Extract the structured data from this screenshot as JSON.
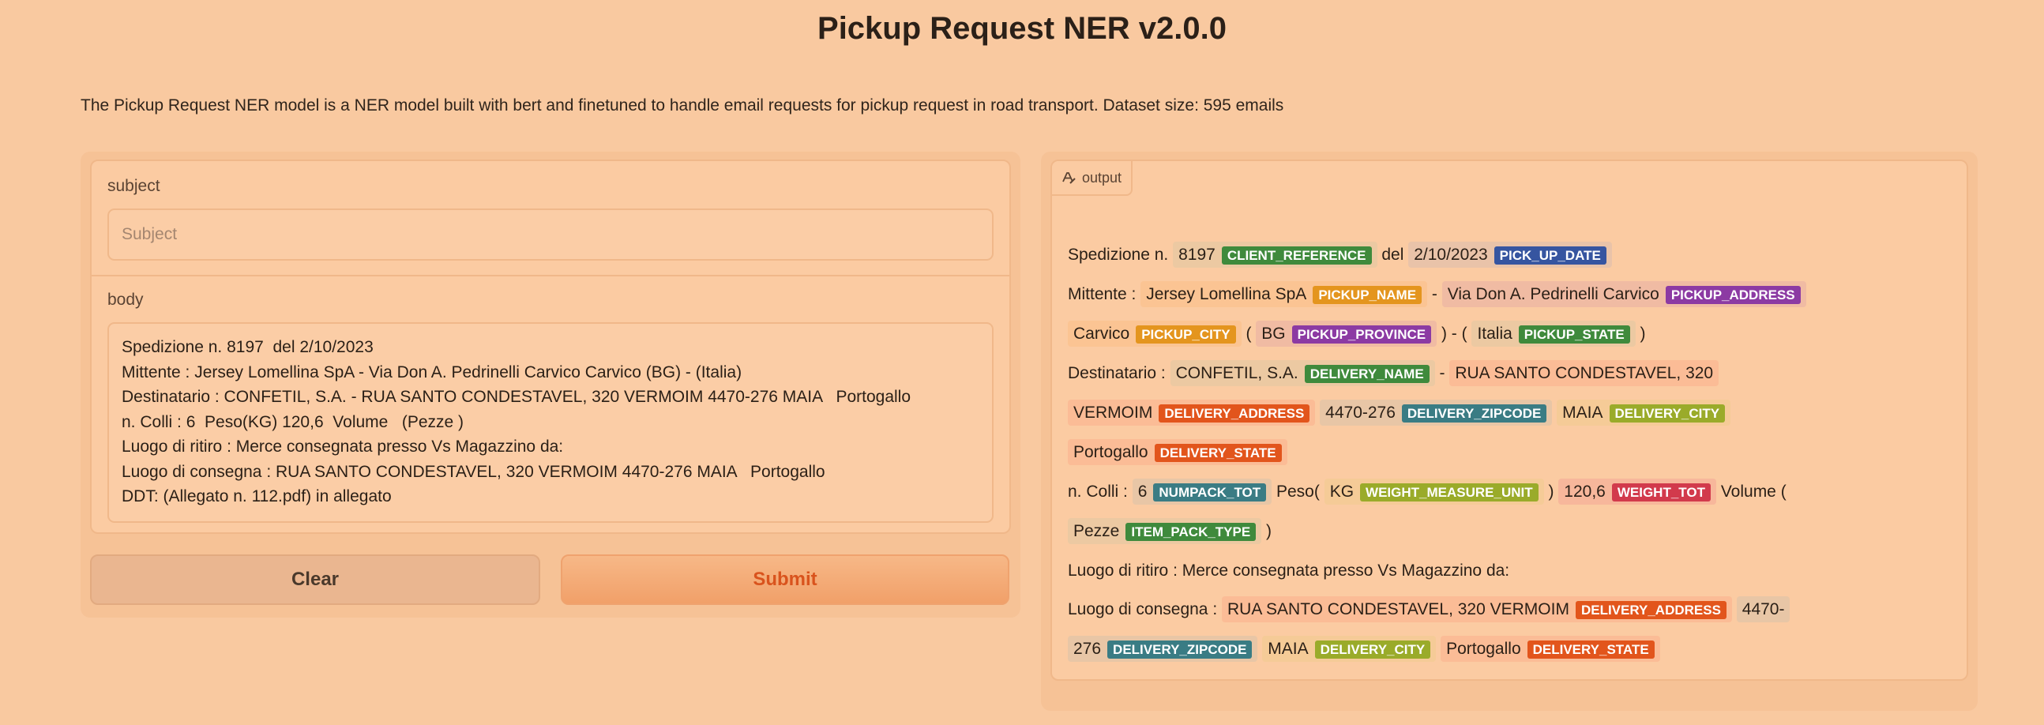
{
  "title": "Pickup Request NER v2.0.0",
  "description": "The Pickup Request NER model is a NER model built with bert and finetuned to handle email requests for pickup request in road transport. Dataset size: 595 emails",
  "form": {
    "subject_label": "subject",
    "subject_placeholder": "Subject",
    "subject_value": "",
    "body_label": "body",
    "body_value": "Spedizione n. 8197  del 2/10/2023\nMittente : Jersey Lomellina SpA - Via Don A. Pedrinelli Carvico Carvico (BG) - (Italia)\nDestinatario : CONFETIL, S.A. - RUA SANTO CONDESTAVEL, 320 VERMOIM 4470-276 MAIA   Portogallo\nn. Colli : 6  Peso(KG) 120,6  Volume   (Pezze )\nLuogo di ritiro : Merce consegnata presso Vs Magazzino da:\nLuogo di consegna : RUA SANTO CONDESTAVEL, 320 VERMOIM 4470-276 MAIA   Portogallo\nDDT: (Allegato n. 112.pdf) in allegato",
    "clear_label": "Clear",
    "submit_label": "Submit"
  },
  "output": {
    "label": "output",
    "label_colors": {
      "CLIENT_REFERENCE": "#3f8a3c",
      "PICK_UP_DATE": "#3655a0",
      "PICKUP_NAME": "#e4951e",
      "PICKUP_ADDRESS": "#8c3aa3",
      "PICKUP_CITY": "#e4951e",
      "PICKUP_PROVINCE": "#8c3aa3",
      "PICKUP_STATE": "#3f8a3c",
      "DELIVERY_NAME": "#3f8a3c",
      "DELIVERY_ADDRESS": "#e2551c",
      "DELIVERY_ZIPCODE": "#3a7c84",
      "DELIVERY_CITY": "#9aab2a",
      "DELIVERY_STATE": "#e2551c",
      "NUMPACK_TOT": "#3a7c84",
      "WEIGHT_MEASURE_UNIT": "#9aab2a",
      "WEIGHT_TOT": "#d23a4c",
      "ITEM_PACK_TYPE": "#3f8a3c"
    },
    "entity_bg": {
      "CLIENT_REFERENCE": "#ecc9a2",
      "PICK_UP_DATE": "#e9c3a9",
      "PICKUP_NAME": "#fbc493",
      "PICKUP_ADDRESS": "#f0bba3",
      "PICKUP_CITY": "#fbc493",
      "PICKUP_PROVINCE": "#f0bba3",
      "PICKUP_STATE": "#ecc9a2",
      "DELIVERY_NAME": "#ecc9a2",
      "DELIVERY_ADDRESS": "#fbbc96",
      "DELIVERY_ZIPCODE": "#e8c6a6",
      "DELIVERY_CITY": "#f5cb97",
      "DELIVERY_STATE": "#fbbc96",
      "NUMPACK_TOT": "#e8c6a6",
      "WEIGHT_MEASURE_UNIT": "#f5cb97",
      "WEIGHT_TOT": "#f7b79b",
      "ITEM_PACK_TYPE": "#ecc9a2"
    },
    "segments": [
      {
        "text": "Spedizione n. "
      },
      {
        "text": "8197",
        "label": "CLIENT_REFERENCE"
      },
      {
        "text": " del "
      },
      {
        "text": "2/10/2023",
        "label": "PICK_UP_DATE"
      },
      {
        "text": "\nMittente : "
      },
      {
        "text": "Jersey Lomellina SpA",
        "label": "PICKUP_NAME"
      },
      {
        "text": " - "
      },
      {
        "text": "Via Don A. Pedrinelli Carvico",
        "label": "PICKUP_ADDRESS"
      },
      {
        "text": " "
      },
      {
        "text": "Carvico",
        "label": "PICKUP_CITY"
      },
      {
        "text": " ( "
      },
      {
        "text": "BG",
        "label": "PICKUP_PROVINCE"
      },
      {
        "text": " ) - ( "
      },
      {
        "text": "Italia",
        "label": "PICKUP_STATE"
      },
      {
        "text": " )\nDestinatario : "
      },
      {
        "text": "CONFETIL, S.A.",
        "label": "DELIVERY_NAME"
      },
      {
        "text": " - "
      },
      {
        "text": "RUA SANTO CONDESTAVEL, 320 VERMOIM",
        "label": "DELIVERY_ADDRESS"
      },
      {
        "text": " "
      },
      {
        "text": "4470-276",
        "label": "DELIVERY_ZIPCODE"
      },
      {
        "text": " "
      },
      {
        "text": "MAIA",
        "label": "DELIVERY_CITY"
      },
      {
        "text": " "
      },
      {
        "text": "Portogallo",
        "label": "DELIVERY_STATE"
      },
      {
        "text": "\nn. Colli : "
      },
      {
        "text": "6",
        "label": "NUMPACK_TOT"
      },
      {
        "text": " Peso( "
      },
      {
        "text": "KG",
        "label": "WEIGHT_MEASURE_UNIT"
      },
      {
        "text": " ) "
      },
      {
        "text": "120,6",
        "label": "WEIGHT_TOT"
      },
      {
        "text": " Volume ( "
      },
      {
        "text": "Pezze",
        "label": "ITEM_PACK_TYPE"
      },
      {
        "text": " )\nLuogo di ritiro : Merce consegnata presso Vs Magazzino da:\nLuogo di consegna : "
      },
      {
        "text": "RUA SANTO CONDESTAVEL, 320 VERMOIM",
        "label": "DELIVERY_ADDRESS"
      },
      {
        "text": " "
      },
      {
        "text": "4470-276",
        "label": "DELIVERY_ZIPCODE"
      },
      {
        "text": " "
      },
      {
        "text": "MAIA",
        "label": "DELIVERY_CITY"
      },
      {
        "text": " "
      },
      {
        "text": "Portogallo",
        "label": "DELIVERY_STATE"
      },
      {
        "text": "\nDDT: (Allegato n. 112.pdf) in allegato"
      }
    ]
  }
}
